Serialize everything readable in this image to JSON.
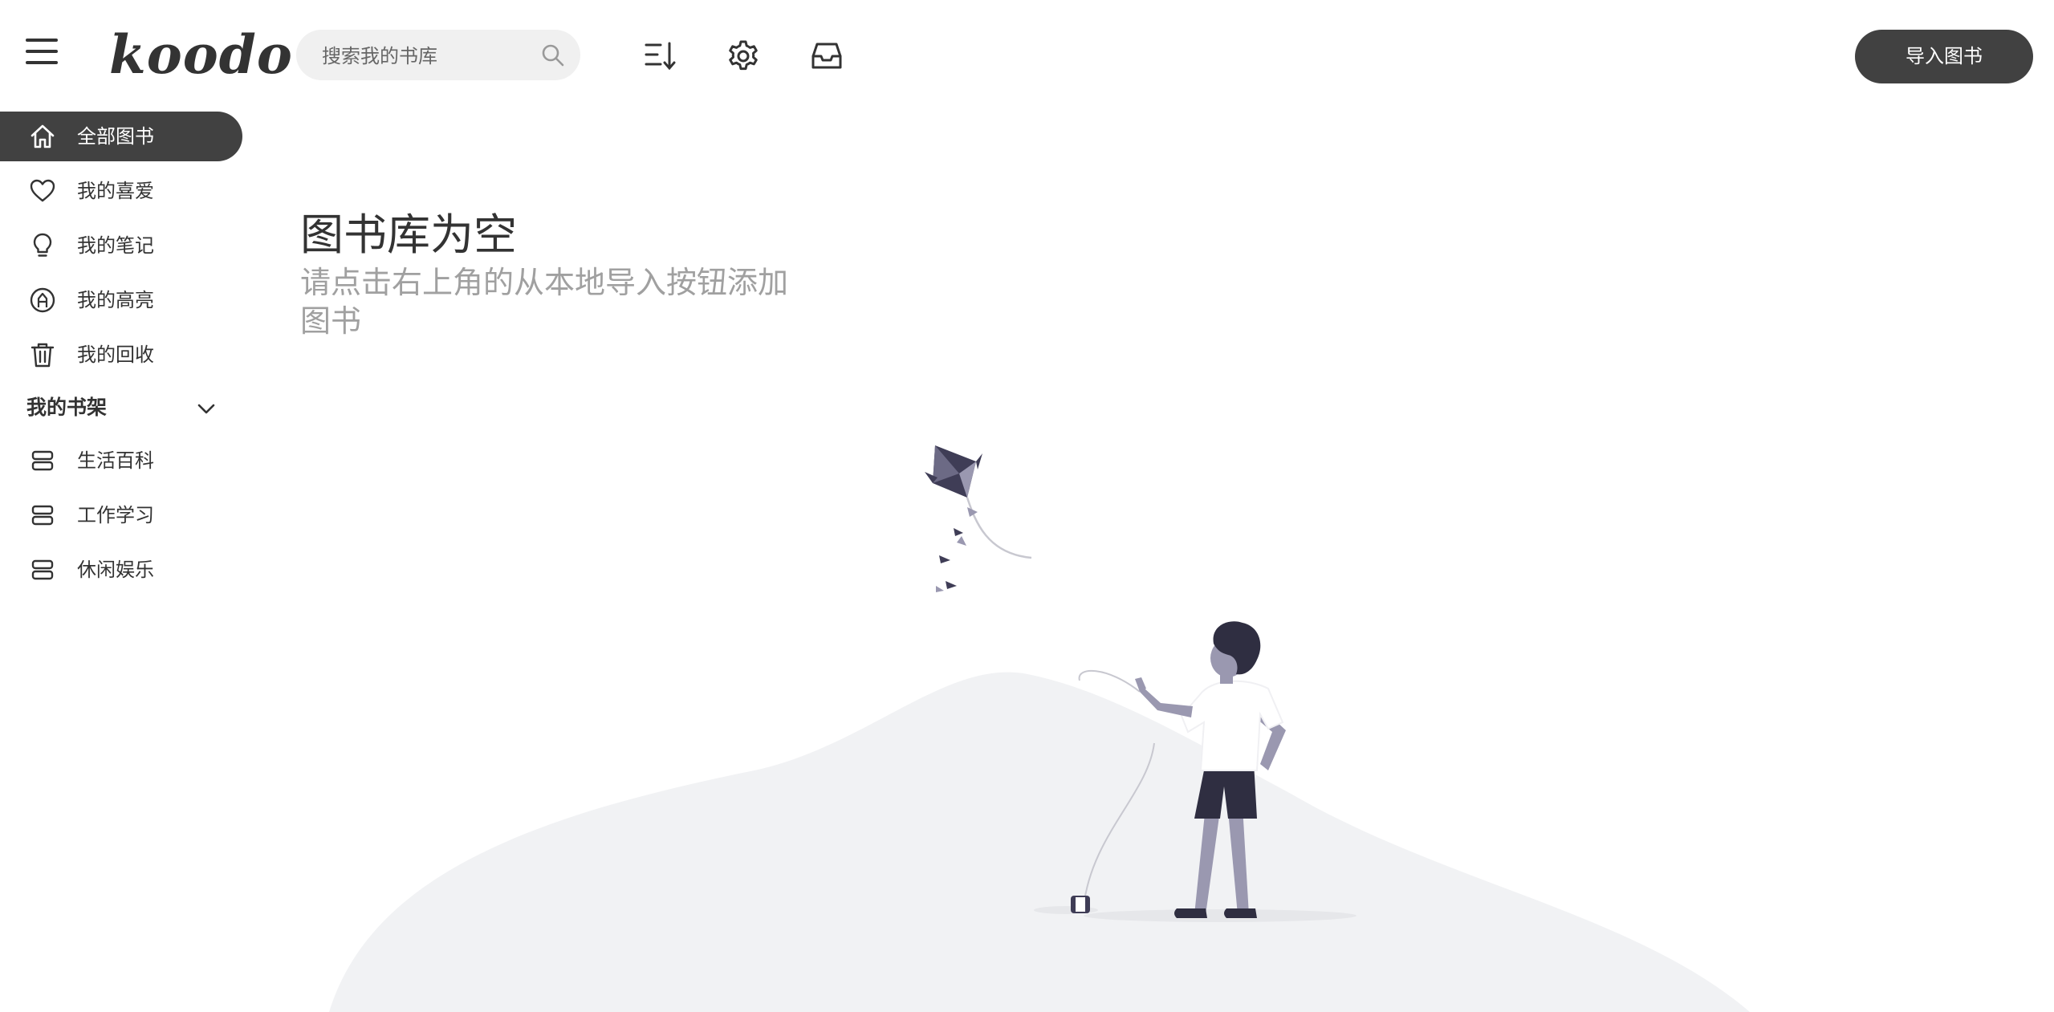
{
  "app": {
    "logo": "koodo"
  },
  "search": {
    "placeholder": "搜索我的书库",
    "value": ""
  },
  "toolbar": {
    "import_label": "导入图书"
  },
  "sidebar": {
    "items": [
      {
        "label": "全部图书",
        "icon": "home-icon",
        "active": true
      },
      {
        "label": "我的喜爱",
        "icon": "heart-icon"
      },
      {
        "label": "我的笔记",
        "icon": "lightbulb-icon"
      },
      {
        "label": "我的高亮",
        "icon": "highlight-icon"
      },
      {
        "label": "我的回收",
        "icon": "trash-icon"
      }
    ],
    "shelf_title": "我的书架",
    "shelves": [
      {
        "label": "生活百科",
        "icon": "shelf-icon"
      },
      {
        "label": "工作学习",
        "icon": "shelf-icon"
      },
      {
        "label": "休闲娱乐",
        "icon": "shelf-icon"
      }
    ]
  },
  "empty": {
    "title": "图书库为空",
    "subtitle": "请点击右上角的从本地导入按钮添加图书"
  },
  "colors": {
    "accent": "#414141",
    "text": "#333333",
    "muted": "#a0a0a0",
    "search_bg": "#f0f0f0",
    "illustration_dark": "#2f2e41"
  }
}
